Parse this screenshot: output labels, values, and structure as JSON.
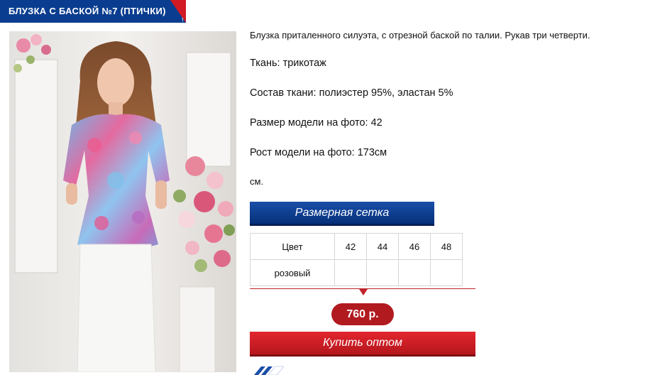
{
  "product": {
    "title": "БЛУЗКА С БАСКОЙ №7 (ПТИЧКИ)",
    "description": "Блузка приталенного силуэта, с отрезной баской по талии. Рукав три четверти.",
    "fabric": "Ткань: трикотаж",
    "composition": "Состав ткани: полиэстер 95%, эластан 5%",
    "model_size": "Размер модели на фото: 42",
    "model_height": "Рост модели на фото: 173см",
    "unit_note": "см."
  },
  "size_chart_button": "Размерная сетка",
  "sizes_table": {
    "header_label": "Цвет",
    "sizes": [
      "42",
      "44",
      "46",
      "48"
    ],
    "rows": [
      {
        "color": "розовый",
        "cells": [
          "",
          "",
          "",
          ""
        ]
      }
    ]
  },
  "price": "760 р.",
  "buy_button": "Купить оптом",
  "colors": {
    "brand_blue": "#0a3d8f",
    "brand_red": "#d11a23",
    "price_red": "#b11a1f"
  }
}
